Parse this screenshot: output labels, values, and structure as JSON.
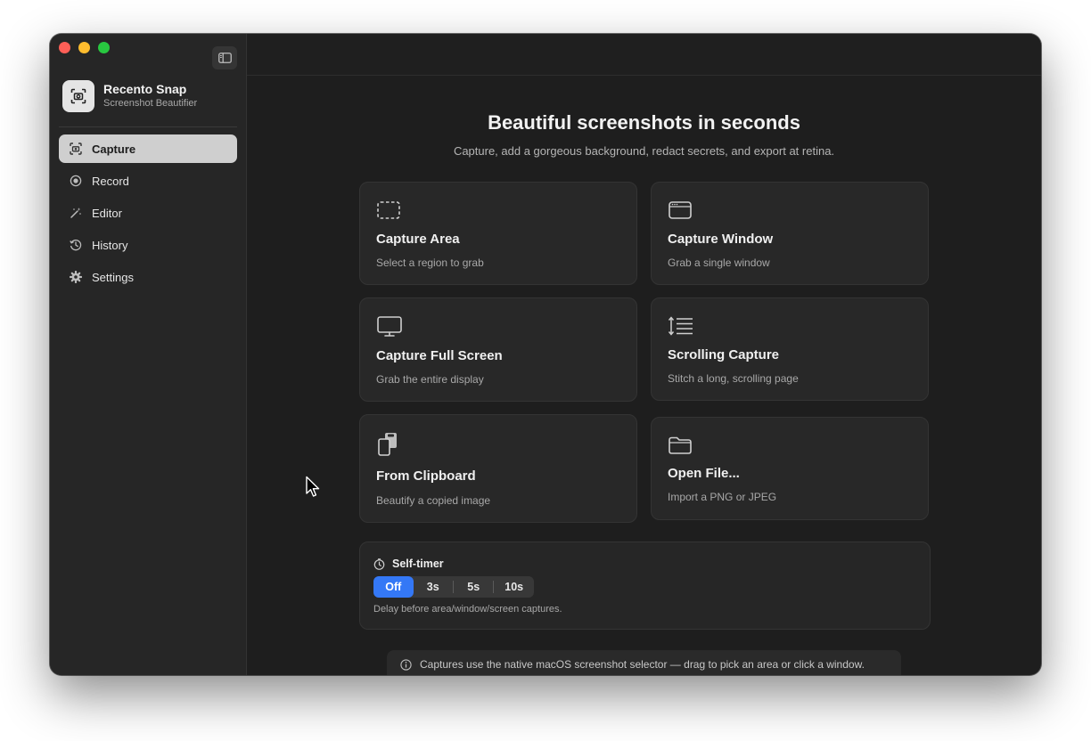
{
  "app": {
    "name": "Recento Snap",
    "subtitle": "Screenshot Beautifier",
    "accent": "#3478f6"
  },
  "sidebar": {
    "items": [
      {
        "label": "Capture",
        "icon": "capture-icon",
        "active": true
      },
      {
        "label": "Record",
        "icon": "record-icon",
        "active": false
      },
      {
        "label": "Editor",
        "icon": "magic-wand-icon",
        "active": false
      },
      {
        "label": "History",
        "icon": "history-icon",
        "active": false
      },
      {
        "label": "Settings",
        "icon": "gear-icon",
        "active": false
      }
    ]
  },
  "main": {
    "title": "Beautiful screenshots in seconds",
    "subtitle": "Capture, add a gorgeous background, redact secrets, and export at retina.",
    "cards": [
      {
        "title": "Capture Area",
        "desc": "Select a region to grab",
        "icon": "dashed-rect-icon"
      },
      {
        "title": "Capture Window",
        "desc": "Grab a single window",
        "icon": "window-icon"
      },
      {
        "title": "Capture Full Screen",
        "desc": "Grab the entire display",
        "icon": "display-icon"
      },
      {
        "title": "Scrolling Capture",
        "desc": "Stitch a long, scrolling page",
        "icon": "scroll-lines-icon"
      },
      {
        "title": "From Clipboard",
        "desc": "Beautify a copied image",
        "icon": "clipboard-icon"
      },
      {
        "title": "Open File...",
        "desc": "Import a PNG or JPEG",
        "icon": "folder-icon"
      }
    ],
    "timer": {
      "label": "Self-timer",
      "options": [
        "Off",
        "3s",
        "5s",
        "10s"
      ],
      "selected": "Off",
      "note": "Delay before area/window/screen captures."
    },
    "info": "Captures use the native macOS screenshot selector — drag to pick an area or click a window."
  }
}
